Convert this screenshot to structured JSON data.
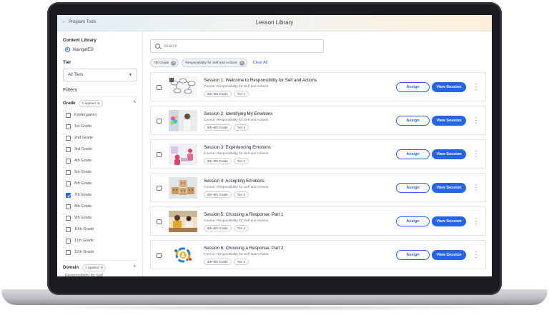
{
  "header": {
    "back_label": "Program Tools",
    "title": "Lesson Library"
  },
  "sidebar": {
    "content_library_label": "Content Library",
    "content_library_option": "NavigatED",
    "tier_label": "Tier",
    "tier_value": "All Tiers",
    "filters_title": "Filters",
    "grade_label": "Grade",
    "grade_applied": "1 applied",
    "grades": [
      {
        "label": "Kindergarten",
        "checked": false
      },
      {
        "label": "1st Grade",
        "checked": false
      },
      {
        "label": "2nd Grade",
        "checked": false
      },
      {
        "label": "3rd Grade",
        "checked": false
      },
      {
        "label": "4th Grade",
        "checked": false
      },
      {
        "label": "5th Grade",
        "checked": false
      },
      {
        "label": "6th Grade",
        "checked": false
      },
      {
        "label": "7th Grade",
        "checked": true
      },
      {
        "label": "8th Grade",
        "checked": false
      },
      {
        "label": "9th Grade",
        "checked": false
      },
      {
        "label": "10th Grade",
        "checked": false
      },
      {
        "label": "11th Grade",
        "checked": false
      },
      {
        "label": "12th Grade",
        "checked": false
      }
    ],
    "domain_label": "Domain",
    "domain_applied": "1 applied",
    "domain_partial": "Responsibility for Self"
  },
  "search": {
    "placeholder": "Search",
    "value": ""
  },
  "active_filters": [
    "7th Grade",
    "Responsibility for Self and Actions"
  ],
  "clear_all_label": "Clear All",
  "assign_label": "Assign",
  "view_label": "View Session",
  "lessons": [
    {
      "title": "Session 1: Welcome to Responsibility for Self and Actions",
      "course": "Course: Responsibility for Self and Actions",
      "grade_tag": "6th–8th Grade",
      "tier_tag": "Tier 2",
      "thumbnail": "diagram-thumbnail"
    },
    {
      "title": "Session 2: Identifying My Emotions",
      "course": "Course: Responsibility for Self and Actions",
      "grade_tag": "6th–8th Grade",
      "tier_tag": "Tier 2",
      "thumbnail": "person-thumbnail"
    },
    {
      "title": "Session 3: Experiencing Emotions",
      "course": "Course: Responsibility for Self and Actions",
      "grade_tag": "6th–8th Grade",
      "tier_tag": "Tier 2",
      "thumbnail": "illustration-thumbnail"
    },
    {
      "title": "Session 4: Accepting Emotions",
      "course": "Course: Responsibility for Self and Actions",
      "grade_tag": "6th–8th Grade",
      "tier_tag": "Tier 2",
      "thumbnail": "emotion-blocks-thumbnail"
    },
    {
      "title": "Session 5: Choosing a Response: Part 1",
      "course": "Course: Responsibility for Self and Actions",
      "grade_tag": "6th–8th Grade",
      "tier_tag": "Tier 2",
      "thumbnail": "classroom-thumbnail"
    },
    {
      "title": "Session 6: Choosing a Response: Part 2",
      "course": "Course: Responsibility for Self and Actions",
      "grade_tag": "6th–8th Grade",
      "tier_tag": "Tier 2",
      "thumbnail": "cycle-thumbnail"
    }
  ],
  "colors": {
    "accent": "#2563eb",
    "text": "#1f2933",
    "muted": "#6b7280"
  }
}
